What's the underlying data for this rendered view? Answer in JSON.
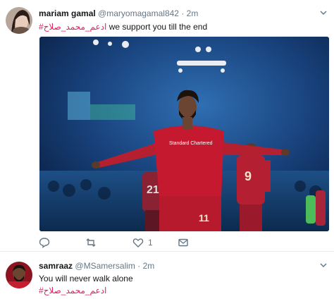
{
  "tweet1": {
    "name": "mariam gamal",
    "handle": "@maryomagamal842",
    "separator": "·",
    "time": "2m",
    "hashtag": "#ادعم_محمد_صلاح",
    "text": " we support you till the end",
    "actions": {
      "reply_count": "",
      "retweet_count": "",
      "like_count": "1"
    },
    "media": {
      "jersey_sponsor": "Standard Chartered",
      "player_number": "11",
      "teammate_number": "9",
      "opponent_number": "21"
    }
  },
  "tweet2": {
    "name": "samraaz",
    "handle": "@MSamersalim",
    "separator": "·",
    "time": "2m",
    "text": "You will never walk alone",
    "hashtag": "#ادعم_محمد_صلاح"
  },
  "colors": {
    "hashtag": "#e0245e",
    "secondary": "#657786",
    "divider": "#e6ecf0"
  }
}
